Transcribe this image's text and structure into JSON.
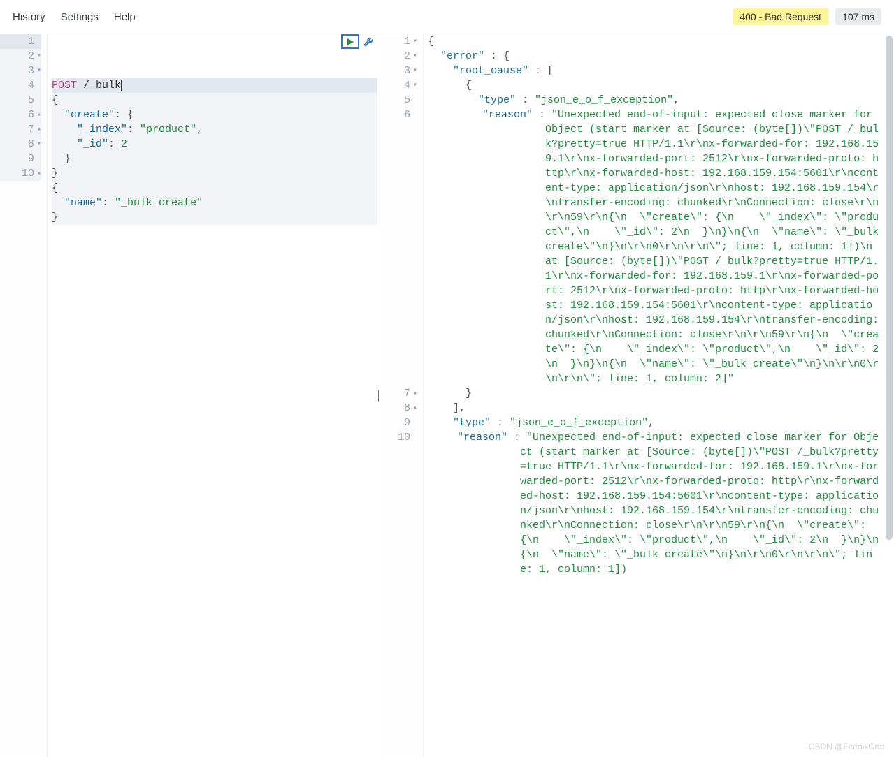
{
  "menu": {
    "history": "History",
    "settings": "Settings",
    "help": "Help"
  },
  "status": {
    "label": "400 - Bad Request",
    "time": "107 ms"
  },
  "request": {
    "lines": [
      {
        "num": "1",
        "fold": "",
        "method": "POST",
        "path": " /_bulk"
      },
      {
        "num": "2",
        "fold": "▾",
        "text": "{"
      },
      {
        "num": "3",
        "fold": "▾",
        "indent": "  ",
        "key": "\"create\"",
        "after": ": {"
      },
      {
        "num": "4",
        "fold": "",
        "indent": "    ",
        "key": "\"_index\"",
        "sep": ": ",
        "val": "\"product\"",
        "after": ","
      },
      {
        "num": "5",
        "fold": "",
        "indent": "    ",
        "key": "\"_id\"",
        "sep": ": ",
        "valnum": "2"
      },
      {
        "num": "6",
        "fold": "▴",
        "indent": "  ",
        "text": "}"
      },
      {
        "num": "7",
        "fold": "▴",
        "text": "}"
      },
      {
        "num": "8",
        "fold": "▾",
        "text": "{"
      },
      {
        "num": "9",
        "fold": "",
        "indent": "  ",
        "key": "\"name\"",
        "sep": ": ",
        "val": "\"_bulk create\""
      },
      {
        "num": "10",
        "fold": "▴",
        "text": "}"
      }
    ]
  },
  "response": {
    "lines": [
      {
        "num": "1",
        "fold": "▾",
        "text": "{"
      },
      {
        "num": "2",
        "fold": "▾",
        "indent": "  ",
        "key": "\"error\"",
        "after": " : {"
      },
      {
        "num": "3",
        "fold": "▾",
        "indent": "    ",
        "key": "\"root_cause\"",
        "after": " : ["
      },
      {
        "num": "4",
        "fold": "▾",
        "indent": "      ",
        "text": "{"
      },
      {
        "num": "5",
        "fold": "",
        "indent": "        ",
        "key": "\"type\"",
        "sep": " : ",
        "val": "\"json_e_o_f_exception\"",
        "after": ","
      },
      {
        "num": "6",
        "fold": "",
        "indent": "        ",
        "key": "\"reason\"",
        "sep": " : ",
        "wrapval": "\"Unexpected end-of-input: expected close marker for Object (start marker at [Source: (byte[])\\\"POST /_bulk?pretty=true HTTP/1.1\\r\\nx-forwarded-for: 192.168.159.1\\r\\nx-forwarded-port: 2512\\r\\nx-forwarded-proto: http\\r\\nx-forwarded-host: 192.168.159.154:5601\\r\\ncontent-type: application/json\\r\\nhost: 192.168.159.154\\r\\ntransfer-encoding: chunked\\r\\nConnection: close\\r\\n\\r\\n59\\r\\n{\\n  \\\"create\\\": {\\n    \\\"_index\\\": \\\"product\\\",\\n    \\\"_id\\\": 2\\n  }\\n}\\n{\\n  \\\"name\\\": \\\"_bulk create\\\"\\n}\\n\\r\\n0\\r\\n\\r\\n\\\"; line: 1, column: 1])\\n at [Source: (byte[])\\\"POST /_bulk?pretty=true HTTP/1.1\\r\\nx-forwarded-for: 192.168.159.1\\r\\nx-forwarded-port: 2512\\r\\nx-forwarded-proto: http\\r\\nx-forwarded-host: 192.168.159.154:5601\\r\\ncontent-type: application/json\\r\\nhost: 192.168.159.154\\r\\ntransfer-encoding: chunked\\r\\nConnection: close\\r\\n\\r\\n59\\r\\n{\\n  \\\"create\\\": {\\n    \\\"_index\\\": \\\"product\\\",\\n    \\\"_id\\\": 2\\n  }\\n}\\n{\\n  \\\"name\\\": \\\"_bulk create\\\"\\n}\\n\\r\\n0\\r\\n\\r\\n\\\"; line: 1, column: 2]\""
      },
      {
        "num": "7",
        "fold": "▴",
        "indent": "      ",
        "text": "}"
      },
      {
        "num": "8",
        "fold": "▴",
        "indent": "    ",
        "text": "],"
      },
      {
        "num": "9",
        "fold": "",
        "indent": "    ",
        "key": "\"type\"",
        "sep": " : ",
        "val": "\"json_e_o_f_exception\"",
        "after": ","
      },
      {
        "num": "10",
        "fold": "",
        "indent": "    ",
        "key": "\"reason\"",
        "sep": " : ",
        "wrapval": "\"Unexpected end-of-input: expected close marker for Object (start marker at [Source: (byte[])\\\"POST /_bulk?pretty=true HTTP/1.1\\r\\nx-forwarded-for: 192.168.159.1\\r\\nx-forwarded-port: 2512\\r\\nx-forwarded-proto: http\\r\\nx-forwarded-host: 192.168.159.154:5601\\r\\ncontent-type: application/json\\r\\nhost: 192.168.159.154\\r\\ntransfer-encoding: chunked\\r\\nConnection: close\\r\\n\\r\\n59\\r\\n{\\n  \\\"create\\\": {\\n    \\\"_index\\\": \\\"product\\\",\\n    \\\"_id\\\": 2\\n  }\\n}\\n{\\n  \\\"name\\\": \\\"_bulk create\\\"\\n}\\n\\r\\n0\\r\\n\\r\\n\\\"; line: 1, column: 1])"
      }
    ]
  },
  "watermark": "CSDN @FeenixOne"
}
